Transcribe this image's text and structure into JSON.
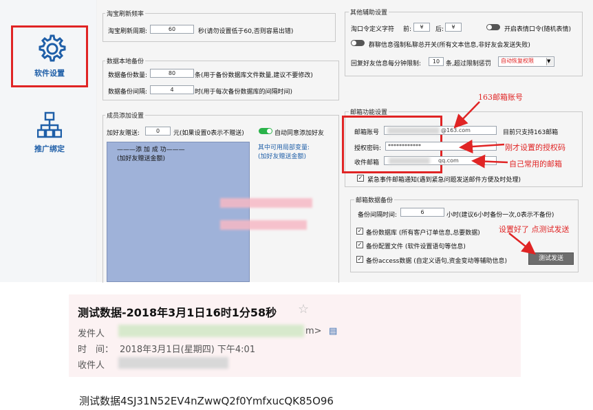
{
  "sidebar": {
    "settings_label": "软件设置",
    "promo_label": "推广绑定"
  },
  "taobao": {
    "title": "淘宝刷新频率",
    "label": "淘宝刷新周期:",
    "value": "60",
    "hint": "秒(请勿设置低于60,否则容易出错)"
  },
  "backup": {
    "title": "数据本地备份",
    "count_label": "数据备份数量:",
    "count_value": "80",
    "count_hint": "条(用于备份数据库文件数量,建议不要修改)",
    "interval_label": "数据备份间隔:",
    "interval_value": "4",
    "interval_hint": "时(用于每次备份数据库的间隔时间)"
  },
  "members": {
    "title": "成员添加设置",
    "gift_label": "加好友赠送:",
    "gift_value": "0",
    "gift_hint": "元(如果设置0表示不赠送)",
    "auto_accept": "自动同意添加好友",
    "box_line1": "———添 加 成 功———",
    "box_line2": "(加好友赠送金额)",
    "var_line1": "其中可用局部变量:",
    "var_line2": "(加好友赠送金额)"
  },
  "other": {
    "title": "其他辅助设置",
    "cmd_label": "淘口令定义字符",
    "front_label": "前:",
    "front_value": "¥",
    "back_label": "后:",
    "back_value": "¥",
    "emoji_cmd": "开启表情口令(随机表情)",
    "group_switch": "群聊信息强制私聊总开关(所有文本信息,非好友会发送失败)",
    "reply_label": "回复好友信息每分钟限制:",
    "reply_value": "10",
    "reply_hint": "条,超过限制惩罚",
    "penalty_value": "自动恢复权限"
  },
  "mail": {
    "title": "邮箱功能设置",
    "account_label": "邮箱账号",
    "account_value": "@163.com",
    "account_hint": "目前只支持163邮箱",
    "auth_label": "授权密码:",
    "auth_value": "************",
    "receive_label": "收件邮箱",
    "receive_value": "qq.com",
    "urgent_label": "紧急事件邮箱通知(遇到紧急问题发送邮件方便及时处理)"
  },
  "mail_backup": {
    "title": "邮箱数据备份",
    "interval_label": "备份间隔时间:",
    "interval_value": "6",
    "interval_hint": "小时(建议6小时备份一次,0表示不备份)",
    "db_label": "备份数据库 (所有客户订单信息,总要数据)",
    "config_label": "备份配置文件 (软件设置语句等信息)",
    "access_label": "备份access数据 (自定义语句,资金变动等辅助信息)",
    "test_button": "测试发送"
  },
  "annotations": {
    "a163": "163邮箱账号",
    "auth": "刚才设置的授权码",
    "receive": "自己常用的邮箱",
    "test": "设置好了 点测试发送"
  },
  "email_view": {
    "subject": "测试数据-2018年3月1日16时1分58秒",
    "sender_label": "发件人",
    "sender_tail": "m>",
    "time_label": "时　间：",
    "time_value": "2018年3月1日(星期四) 下午4:01",
    "recipient_label": "收件人",
    "body": "测试数据4SJ31N52EV4nZwwQ2f0YmfxucQK85O96"
  },
  "colors": {
    "accent": "#1f5fa8",
    "highlight": "#e02424",
    "toggle_on": "#2ab34a",
    "mail_bg": "#fcf2f3"
  }
}
